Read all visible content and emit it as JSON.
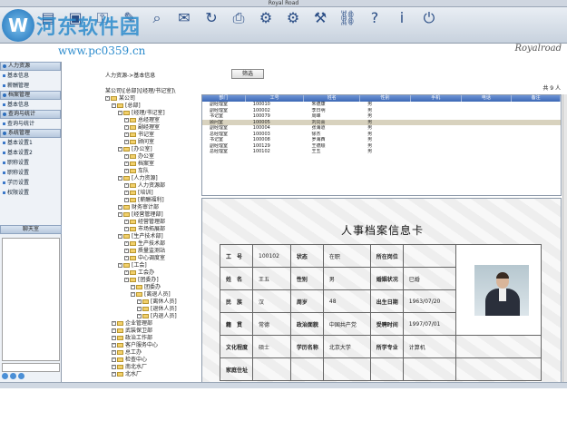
{
  "window": {
    "title": "Royal Road"
  },
  "watermark": {
    "name": "河东软件园",
    "url": "www.pc0359.cn"
  },
  "brand": "Royalroad",
  "toolbar": [
    {
      "label": "",
      "icon": "user-icon"
    },
    {
      "label": "",
      "icon": "document-icon"
    },
    {
      "label": "",
      "icon": "folder-icon"
    },
    {
      "label": "",
      "icon": "key-icon"
    },
    {
      "label": "",
      "icon": "edit-icon"
    },
    {
      "label": "",
      "icon": "search-icon"
    },
    {
      "label": "",
      "icon": "mail-icon"
    },
    {
      "label": "",
      "icon": "refresh-icon"
    },
    {
      "label": "",
      "icon": "print-icon"
    },
    {
      "label": "",
      "icon": "config-icon"
    },
    {
      "label": "",
      "icon": "settings-icon"
    },
    {
      "label": "",
      "icon": "tools-icon"
    },
    {
      "label": "",
      "icon": "link-icon"
    },
    {
      "label": "",
      "icon": "help-icon"
    },
    {
      "label": "",
      "icon": "info-icon"
    },
    {
      "label": "",
      "icon": "exit-icon"
    }
  ],
  "sidebar": {
    "sections": [
      {
        "title": "人力资源",
        "items": [
          "基本信息",
          "薪酬管理"
        ]
      },
      {
        "title": "档案管理",
        "items": [
          "基本信息"
        ]
      },
      {
        "title": "查询与统计",
        "items": [
          "查询与统计"
        ]
      },
      {
        "title": "系统管理",
        "items": [
          "基本设置1",
          "基本设置2",
          "职称设置",
          "职称设置",
          "学历设置",
          "权限设置"
        ]
      }
    ],
    "chat_title": "聊天室"
  },
  "main": {
    "breadcrumb": "人力资源->基本信息",
    "query_button": "筛选",
    "path": "某公司\\[总部]\\[经理/书记室]\\",
    "count": "共 9 人",
    "tree": [
      {
        "label": "某公司",
        "level": 0
      },
      {
        "label": "[总部]",
        "level": 1
      },
      {
        "label": "[经理/书记室]",
        "level": 2
      },
      {
        "label": "总经理室",
        "level": 3
      },
      {
        "label": "副经理室",
        "level": 3
      },
      {
        "label": "书记室",
        "level": 3
      },
      {
        "label": "顾问室",
        "level": 3
      },
      {
        "label": "[办公室]",
        "level": 2
      },
      {
        "label": "办公室",
        "level": 3
      },
      {
        "label": "档案室",
        "level": 3
      },
      {
        "label": "车队",
        "level": 3
      },
      {
        "label": "[人力资源]",
        "level": 2
      },
      {
        "label": "人力资源部",
        "level": 3
      },
      {
        "label": "[培训]",
        "level": 3
      },
      {
        "label": "[薪酬福利]",
        "level": 3
      },
      {
        "label": "财务审计部",
        "level": 2
      },
      {
        "label": "[经营管理部]",
        "level": 2
      },
      {
        "label": "经营管理部",
        "level": 3
      },
      {
        "label": "市场拓展部",
        "level": 3
      },
      {
        "label": "[生产技术部]",
        "level": 2
      },
      {
        "label": "生产技术部",
        "level": 3
      },
      {
        "label": "质量监测站",
        "level": 3
      },
      {
        "label": "中心调度室",
        "level": 3
      },
      {
        "label": "[工会]",
        "level": 2
      },
      {
        "label": "工会办",
        "level": 3
      },
      {
        "label": "[团委办]",
        "level": 3
      },
      {
        "label": "团委办",
        "level": 4
      },
      {
        "label": "[离退人员]",
        "level": 4
      },
      {
        "label": "[离休人员]",
        "level": 5
      },
      {
        "label": "[退休人员]",
        "level": 5
      },
      {
        "label": "[内退人员]",
        "level": 5
      },
      {
        "label": "企业管理部",
        "level": 1
      },
      {
        "label": "武装保卫部",
        "level": 1
      },
      {
        "label": "政治工作部",
        "level": 1
      },
      {
        "label": "客户服务中心",
        "level": 1
      },
      {
        "label": "总工办",
        "level": 1
      },
      {
        "label": "检查中心",
        "level": 1
      },
      {
        "label": "南北水厂",
        "level": 1
      },
      {
        "label": "北水厂",
        "level": 1
      }
    ],
    "grid": {
      "columns": [
        "部门",
        "工号",
        "姓名",
        "性别",
        "手机",
        "电话",
        "备注"
      ],
      "rows": [
        [
          "副经理室",
          "100010",
          "朱德康",
          "男",
          "",
          "",
          ""
        ],
        [
          "副经理室",
          "100002",
          "李日明",
          "男",
          "",
          "",
          ""
        ],
        [
          "书记室",
          "100079",
          "周峰",
          "男",
          "",
          "",
          ""
        ],
        [
          "顾问室",
          "100005",
          "刘同喜",
          "男",
          "",
          "",
          ""
        ],
        [
          "副经理室",
          "100004",
          "张海道",
          "男",
          "",
          "",
          ""
        ],
        [
          "总经理室",
          "100003",
          "徐杰",
          "男",
          "",
          "",
          ""
        ],
        [
          "书记室",
          "100008",
          "罗海西",
          "男",
          "",
          "",
          ""
        ],
        [
          "副经理室",
          "100129",
          "王德顺",
          "男",
          "",
          "",
          ""
        ],
        [
          "总经理室",
          "100102",
          "王五",
          "男",
          "",
          "",
          ""
        ]
      ],
      "selected_row": 3
    },
    "card": {
      "title": "人事档案信息卡",
      "rows": [
        [
          {
            "k": "工　号"
          },
          {
            "v": "100102"
          },
          {
            "k": "状态"
          },
          {
            "v": "在职"
          },
          {
            "k": "所在岗位"
          },
          {
            "v": ""
          }
        ],
        [
          {
            "k": "姓　名"
          },
          {
            "v": "王五"
          },
          {
            "k": "性别"
          },
          {
            "v": "男"
          },
          {
            "k": "婚姻状况"
          },
          {
            "v": "已婚"
          }
        ],
        [
          {
            "k": "民　族"
          },
          {
            "v": "汉"
          },
          {
            "k": "周岁"
          },
          {
            "v": "48"
          },
          {
            "k": "出生日期"
          },
          {
            "v": "1963/07/20"
          }
        ],
        [
          {
            "k": "籍　贯"
          },
          {
            "v": "常德"
          },
          {
            "k": "政治面貌"
          },
          {
            "v": "中国共产党"
          },
          {
            "k": "受聘时间"
          },
          {
            "v": "1997/07/01"
          }
        ],
        [
          {
            "k": "文化程度"
          },
          {
            "v": "硕士"
          },
          {
            "k": "学历名称"
          },
          {
            "v": "北京大学"
          },
          {
            "k": "所学专业"
          },
          {
            "v": "计算机"
          }
        ],
        [
          {
            "k": "家庭住址"
          },
          {
            "v": ""
          },
          {
            "k": ""
          },
          {
            "v": ""
          },
          {
            "k": ""
          },
          {
            "v": ""
          }
        ]
      ]
    }
  },
  "status": ""
}
